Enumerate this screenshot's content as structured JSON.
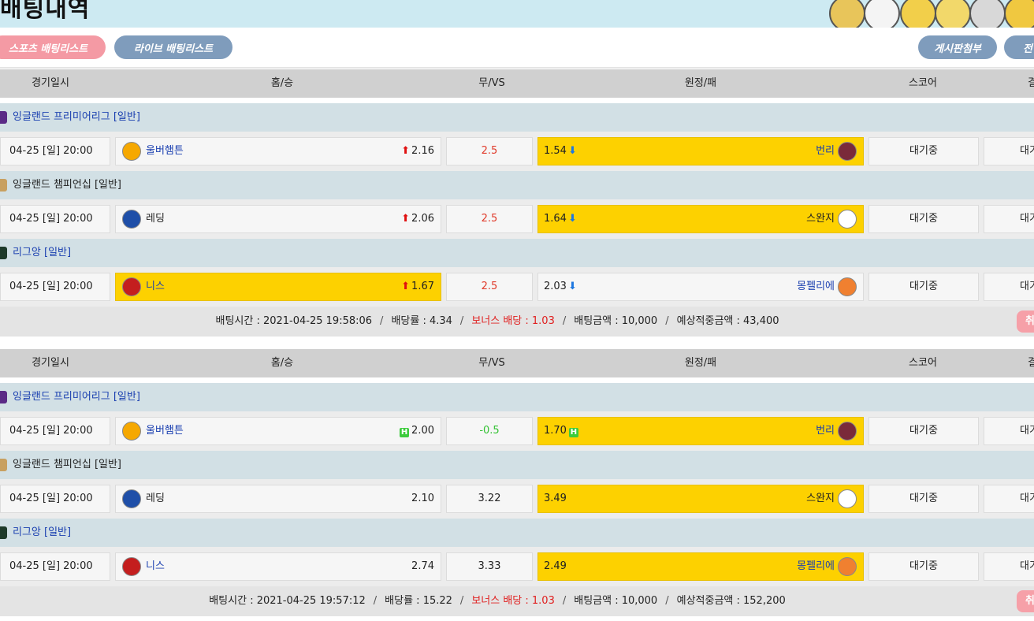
{
  "page": {
    "title": "배팅내역",
    "nav": {
      "sports_list": "스포츠 배팅리스트",
      "live_list": "라이브 배팅리스트",
      "board_attach": "게시판첨부",
      "all": "전"
    }
  },
  "columns": [
    "경기일시",
    "홈/승",
    "무/VS",
    "원정/패",
    "스코어",
    "결"
  ],
  "colors": {
    "highlight": "#fdd100",
    "league_bar": "#d2e0e5",
    "header_bar": "#d0d0d0",
    "odds_up": "#e01010",
    "odds_down": "#1e78e0",
    "handicap": "#34c234"
  },
  "slips": [
    {
      "games": [
        {
          "league": "잉글랜드 프리미어리그 [일반]",
          "league_color": "#1a3fb0",
          "league_icon_color": "#5b2a86",
          "date": "04-25 [일] 20:00",
          "home": "울버햄튼",
          "home_color": "#1a3fb0",
          "home_logo_color": "#f6a800",
          "home_odds": "2.16",
          "home_mark": "up",
          "draw": "2.5",
          "draw_color": "#e03a2a",
          "away": "번리",
          "away_color": "#1a3fb0",
          "away_logo_color": "#7a2a3a",
          "away_odds": "1.54",
          "away_mark": "down",
          "selected": "away",
          "score": "대기중",
          "result": "대기"
        },
        {
          "league": "잉글랜드 챔피언십 [일반]",
          "league_color": "#222222",
          "league_icon_color": "#c8a060",
          "date": "04-25 [일] 20:00",
          "home": "레딩",
          "home_color": "#222222",
          "home_logo_color": "#1f4fa8",
          "home_odds": "2.06",
          "home_mark": "up",
          "draw": "2.5",
          "draw_color": "#e03a2a",
          "away": "스완지",
          "away_color": "#222222",
          "away_logo_color": "#ffffff",
          "away_odds": "1.64",
          "away_mark": "down",
          "selected": "away",
          "score": "대기중",
          "result": "대기"
        },
        {
          "league": "리그앙 [일반]",
          "league_color": "#1a3fb0",
          "league_icon_color": "#1e3a2a",
          "date": "04-25 [일] 20:00",
          "home": "니스",
          "home_color": "#1a3fb0",
          "home_logo_color": "#c41e1e",
          "home_odds": "1.67",
          "home_mark": "up",
          "draw": "2.5",
          "draw_color": "#e03a2a",
          "away": "몽펠리에",
          "away_color": "#1a3fb0",
          "away_logo_color": "#f08030",
          "away_odds": "2.03",
          "away_mark": "down",
          "selected": "home",
          "score": "대기중",
          "result": "대기"
        }
      ],
      "summary": {
        "bet_time": "배팅시간 : 2021-04-25 19:58:06",
        "odds": "배당률 : 4.34",
        "bonus": "보너스 배당 : 1.03",
        "amount": "배팅금액 : 10,000",
        "expected": "예상적중금액 : 43,400",
        "cancel": "취"
      }
    },
    {
      "games": [
        {
          "league": "잉글랜드 프리미어리그 [일반]",
          "league_color": "#1a3fb0",
          "league_icon_color": "#5b2a86",
          "date": "04-25 [일] 20:00",
          "home": "울버햄튼",
          "home_color": "#1a3fb0",
          "home_logo_color": "#f6a800",
          "home_odds": "2.00",
          "home_mark": "handicap",
          "draw": "-0.5",
          "draw_color": "#34c234",
          "away": "번리",
          "away_color": "#1a3fb0",
          "away_logo_color": "#7a2a3a",
          "away_odds": "1.70",
          "away_mark": "handicap",
          "selected": "away",
          "score": "대기중",
          "result": "대기"
        },
        {
          "league": "잉글랜드 챔피언십 [일반]",
          "league_color": "#222222",
          "league_icon_color": "#c8a060",
          "date": "04-25 [일] 20:00",
          "home": "레딩",
          "home_color": "#222222",
          "home_logo_color": "#1f4fa8",
          "home_odds": "2.10",
          "home_mark": "none",
          "draw": "3.22",
          "draw_color": "#222222",
          "away": "스완지",
          "away_color": "#222222",
          "away_logo_color": "#ffffff",
          "away_odds": "3.49",
          "away_mark": "none",
          "selected": "away",
          "score": "대기중",
          "result": "대기"
        },
        {
          "league": "리그앙 [일반]",
          "league_color": "#1a3fb0",
          "league_icon_color": "#1e3a2a",
          "date": "04-25 [일] 20:00",
          "home": "니스",
          "home_color": "#1a3fb0",
          "home_logo_color": "#c41e1e",
          "home_odds": "2.74",
          "home_mark": "none",
          "draw": "3.33",
          "draw_color": "#222222",
          "away": "몽펠리에",
          "away_color": "#1a3fb0",
          "away_logo_color": "#f08030",
          "away_odds": "2.49",
          "away_mark": "none",
          "selected": "away",
          "score": "대기중",
          "result": "대기"
        }
      ],
      "summary": {
        "bet_time": "배팅시간 : 2021-04-25 19:57:12",
        "odds": "배당률 : 15.22",
        "bonus": "보너스 배당 : 1.03",
        "amount": "배팅금액 : 10,000",
        "expected": "예상적중금액 : 152,200",
        "cancel": "취"
      }
    }
  ]
}
